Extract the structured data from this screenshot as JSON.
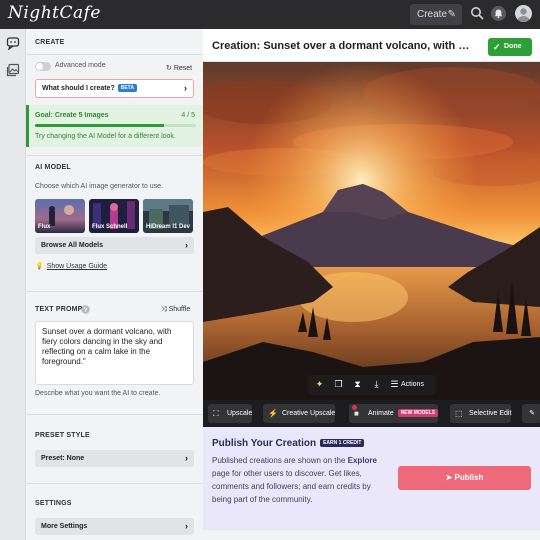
{
  "header": {
    "logo": "NightCafe",
    "create_label": "Create",
    "icons": [
      "pencil-icon",
      "search-icon",
      "bell-icon",
      "avatar"
    ]
  },
  "sidebar_strip": {
    "icons": [
      "create-icon",
      "gallery-icon"
    ]
  },
  "panel": {
    "section_create": "CREATE",
    "advanced_mode": "Advanced mode",
    "reset": "Reset",
    "what_create": "What should I create?",
    "beta_badge": "BETA",
    "goal": {
      "title": "Goal: Create 5 Images",
      "count": "4 / 5",
      "progress": 0.8,
      "hint": "Try changing the AI Model for a different look."
    },
    "ai_model": {
      "title": "AI MODEL",
      "subtitle": "Choose which AI image generator to use.",
      "models": [
        "Flux",
        "Flux Schnell",
        "HiDream I1 Dev"
      ],
      "browse": "Browse All Models",
      "usage_guide": "Show Usage Guide"
    },
    "text_prompt": {
      "title": "TEXT PROMPT",
      "shuffle": "Shuffle",
      "value": "Sunset over a dormant volcano, with fiery colors dancing in the sky and reflecting on a calm lake in the foreground.\"",
      "hint": "Describe what you want the AI to create."
    },
    "preset": {
      "title": "PRESET STYLE",
      "value": "Preset: None"
    },
    "settings": {
      "title": "SETTINGS",
      "more": "More Settings"
    }
  },
  "main": {
    "title": "Creation: Sunset over a dormant volcano, with …",
    "done": "Done",
    "actions_label": "Actions",
    "tools": [
      {
        "label": "Upscale",
        "icon": "upscale-icon"
      },
      {
        "label": "Creative Upscale",
        "icon": "magic-wand-icon"
      },
      {
        "label": "Animate",
        "icon": "video-camera-icon",
        "badge": "NEW MODELS"
      },
      {
        "label": "Selective Edit",
        "icon": "selection-icon"
      }
    ],
    "publish": {
      "title": "Publish Your Creation",
      "badge": "EARN 1 CREDIT",
      "text_before": "Published creations are shown on the ",
      "text_link": "Explore",
      "text_after": " page for other users to discover. Get likes, comments and followers; and earn credits by being part of the community.",
      "button": "Publish"
    }
  },
  "colors": {
    "topbar": "#2b2b2e",
    "done_green": "#2e9e37",
    "publish_pink": "#ee6a78",
    "publish_bg": "#ebe7fb",
    "goal_green": "#2f9a3c"
  }
}
